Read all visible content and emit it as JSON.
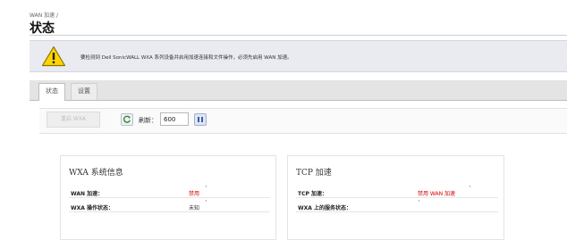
{
  "breadcrumb": "WAN 加速 /",
  "title": "状态",
  "alert": {
    "icon": "warning-triangle-icon",
    "text": "要检测到 Dell SonicWALL WXA 系列设备并启用加速连接和文件操作，必须先启用 WAN 加速。"
  },
  "tabs": [
    {
      "label": "状态",
      "active": true
    },
    {
      "label": "设置",
      "active": false
    }
  ],
  "toolbar": {
    "reset_label": "重启 WXA",
    "refresh_label": "刷新：",
    "refresh_value": "600"
  },
  "panels": {
    "wxa": {
      "title": "WXA 系统信息",
      "rows": [
        {
          "label": "WAN 加速：",
          "value": "禁用",
          "marker": "`"
        },
        {
          "label": "WXA 操作状态：",
          "value": "未知",
          "marker": "`"
        }
      ]
    },
    "tcp": {
      "title": "TCP 加速",
      "rows": [
        {
          "label": "TCP 加速：",
          "value": "禁用 WAN 加速",
          "marker": "`"
        },
        {
          "label": "WXA 上的服务状态：",
          "value": "",
          "marker": "`"
        }
      ]
    }
  },
  "colors": {
    "disabled_text": "#d60000",
    "warning_fill": "#ffd400",
    "alert_background": "#e9ebf1"
  }
}
